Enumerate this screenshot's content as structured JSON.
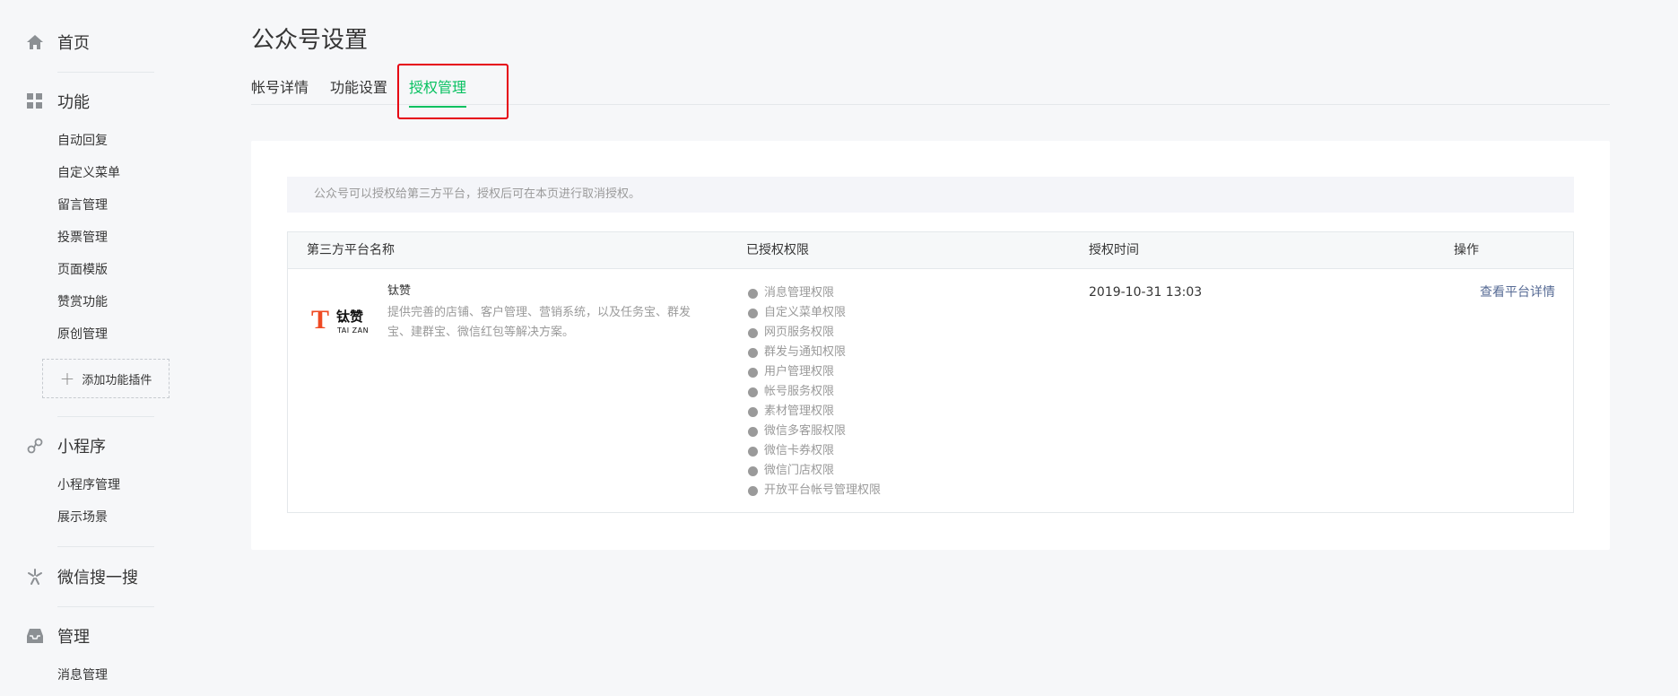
{
  "sidebar": {
    "home": {
      "label": "首页",
      "icon": "home-icon"
    },
    "functions": {
      "label": "功能",
      "icon": "grid-icon",
      "items": [
        "自动回复",
        "自定义菜单",
        "留言管理",
        "投票管理",
        "页面模版",
        "赞赏功能",
        "原创管理"
      ],
      "add_plugin": "添加功能插件"
    },
    "miniprogram": {
      "label": "小程序",
      "icon": "link-icon",
      "items": [
        "小程序管理",
        "展示场景"
      ]
    },
    "search": {
      "label": "微信搜一搜",
      "icon": "search-star-icon"
    },
    "manage": {
      "label": "管理",
      "icon": "inbox-icon",
      "items": [
        "消息管理"
      ]
    }
  },
  "main": {
    "title": "公众号设置",
    "tabs": [
      {
        "label": "帐号详情",
        "active": false
      },
      {
        "label": "功能设置",
        "active": false
      },
      {
        "label": "授权管理",
        "active": true
      }
    ],
    "notice": "公众号可以授权给第三方平台，授权后可在本页进行取消授权。",
    "table": {
      "headers": [
        "第三方平台名称",
        "已授权权限",
        "授权时间",
        "操作"
      ],
      "rows": [
        {
          "logo": {
            "mark": "T",
            "cn": "钛赞",
            "en": "TAI ZAN"
          },
          "name": "钛赞",
          "description": "提供完善的店铺、客户管理、营销系统，以及任务宝、群发宝、建群宝、微信红包等解决方案。",
          "permissions": [
            "消息管理权限",
            "自定义菜单权限",
            "网页服务权限",
            "群发与通知权限",
            "用户管理权限",
            "帐号服务权限",
            "素材管理权限",
            "微信多客服权限",
            "微信卡券权限",
            "微信门店权限",
            "开放平台帐号管理权限"
          ],
          "time": "2019-10-31 13:03",
          "action": "查看平台详情"
        }
      ]
    }
  },
  "colors": {
    "accent": "#07c160",
    "link": "#576b95",
    "highlight_box": "#e60012",
    "logo_orange": "#ef4a23"
  }
}
